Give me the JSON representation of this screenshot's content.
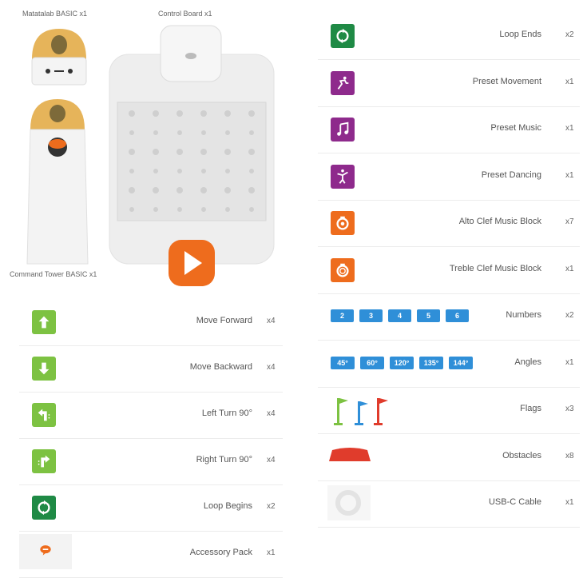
{
  "colors": {
    "green_light": "#7dc242",
    "green_dark": "#1f8a45",
    "purple": "#8e2a8c",
    "orange": "#ee6c1d",
    "blue": "#2f8fd8",
    "red": "#e03c2c",
    "wood": "#c9a85a"
  },
  "robots": {
    "matatalab": "Matatalab BASIC x1",
    "board": "Control Board x1",
    "tower": "Command Tower BASIC x1"
  },
  "left_items": [
    {
      "icon": "arrow-up-icon",
      "name": "Move Forward",
      "qty": "x4"
    },
    {
      "icon": "arrow-down-icon",
      "name": "Move Backward",
      "qty": "x4"
    },
    {
      "icon": "turn-left-icon",
      "name": "Left Turn 90°",
      "qty": "x4"
    },
    {
      "icon": "turn-right-icon",
      "name": "Right Turn 90°",
      "qty": "x4"
    },
    {
      "icon": "loop-icon",
      "name": "Loop Begins",
      "qty": "x2"
    },
    {
      "icon": "chat-bubble-icon",
      "name": "Accessory Pack",
      "qty": "x1"
    }
  ],
  "right_items": [
    {
      "icon": "loop-icon",
      "name": "Loop Ends",
      "qty": "x2"
    },
    {
      "icon": "running-person-icon",
      "name": "Preset Movement",
      "qty": "x1"
    },
    {
      "icon": "music-note-icon",
      "name": "Preset Music",
      "qty": "x1"
    },
    {
      "icon": "dancer-icon",
      "name": "Preset Dancing",
      "qty": "x1"
    },
    {
      "icon": "alto-clef-icon",
      "name": "Alto Clef Music Block",
      "qty": "x7"
    },
    {
      "icon": "treble-clef-icon",
      "name": "Treble Clef Music Block",
      "qty": "x1"
    },
    {
      "icon": "number-chips",
      "name": "Numbers",
      "qty": "x2"
    },
    {
      "icon": "angle-chips",
      "name": "Angles",
      "qty": "x1"
    },
    {
      "icon": "flags-icon",
      "name": "Flags",
      "qty": "x3"
    },
    {
      "icon": "obstacle-icon",
      "name": "Obstacles",
      "qty": "x8"
    },
    {
      "icon": "usb-cable-icon",
      "name": "USB-C Cable",
      "qty": "x1"
    }
  ],
  "numbers": [
    "2",
    "3",
    "4",
    "5",
    "6"
  ],
  "angles": [
    "45°",
    "60°",
    "120°",
    "135°",
    "144°"
  ]
}
